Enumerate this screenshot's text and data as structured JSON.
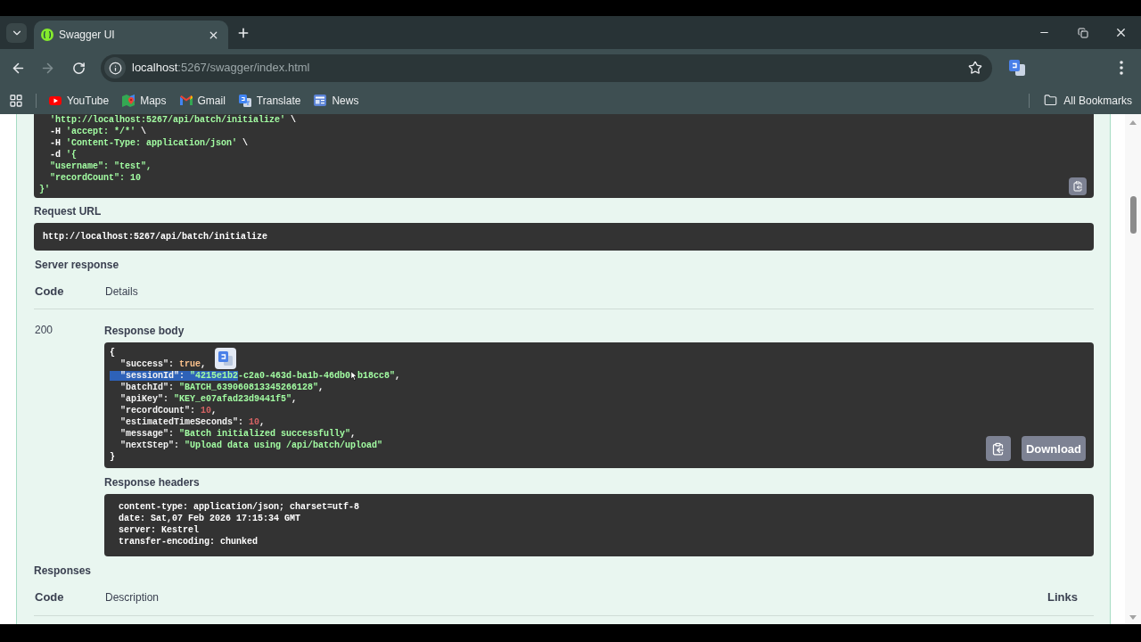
{
  "browser": {
    "tab": {
      "title": "Swagger UI",
      "selected": true
    },
    "address": {
      "host": "localhost",
      "path": ":5267/swagger/index.html"
    },
    "bookmarks": [
      {
        "label": "YouTube",
        "kind": "video"
      },
      {
        "label": "Maps",
        "kind": "map"
      },
      {
        "label": "Gmail",
        "kind": "mail"
      },
      {
        "label": "Translate",
        "kind": "translate"
      },
      {
        "label": "News",
        "kind": "news"
      }
    ],
    "all_bookmarks": "All Bookmarks"
  },
  "curl": {
    "lines": [
      [
        {
          "text": "  'http://localhost:5267/api/batch/initialize'",
          "kind": "string"
        },
        {
          "text": " \\",
          "kind": "plain"
        }
      ],
      [
        {
          "text": "  -H ",
          "kind": "plain"
        },
        {
          "text": "'accept: */*'",
          "kind": "string"
        },
        {
          "text": " \\",
          "kind": "plain"
        }
      ],
      [
        {
          "text": "  -H ",
          "kind": "plain"
        },
        {
          "text": "'Content-Type: application/json'",
          "kind": "string"
        },
        {
          "text": " \\",
          "kind": "plain"
        }
      ],
      [
        {
          "text": "  -d ",
          "kind": "plain"
        },
        {
          "text": "'{",
          "kind": "string"
        }
      ],
      [
        {
          "text": "  \"username\": \"test\",",
          "kind": "string"
        }
      ],
      [
        {
          "text": "  \"recordCount\": 10",
          "kind": "string"
        }
      ],
      [
        {
          "text": "}'",
          "kind": "string"
        }
      ]
    ]
  },
  "request_url": {
    "label": "Request URL",
    "value": "http://localhost:5267/api/batch/initialize"
  },
  "server_response": {
    "label": "Server response",
    "columns": [
      "Code",
      "Details"
    ],
    "rows": [
      {
        "code": "200",
        "response_body": {
          "label": "Response body",
          "download": "Download",
          "lines": [
            [
              {
                "text": "{",
                "kind": "punct",
                "selected": false
              }
            ],
            [
              {
                "text": "  \"success\": ",
                "kind": "key",
                "selected": false
              },
              {
                "text": "true",
                "kind": "literal",
                "selected": false
              },
              {
                "text": ",",
                "kind": "punct",
                "selected": false
              }
            ],
            [
              {
                "text": "  \"sessionId\": ",
                "kind": "key",
                "selected": true
              },
              {
                "text": "\"4215e1b2",
                "kind": "string",
                "selected": true
              },
              {
                "text": "-c2a0-463d-ba1b-46db0",
                "kind": "string",
                "selected": false,
                "pointer_after": true
              },
              {
                "text": "b18cc8\"",
                "kind": "string",
                "selected": false
              },
              {
                "text": ",",
                "kind": "punct",
                "selected": false
              }
            ],
            [
              {
                "text": "  \"batchId\": ",
                "kind": "key",
                "selected": false
              },
              {
                "text": "\"BATCH_639060813345266128\"",
                "kind": "string",
                "selected": false
              },
              {
                "text": ",",
                "kind": "punct",
                "selected": false
              }
            ],
            [
              {
                "text": "  \"apiKey\": ",
                "kind": "key",
                "selected": false
              },
              {
                "text": "\"KEY_e07afad23d9441f5\"",
                "kind": "string",
                "selected": false
              },
              {
                "text": ",",
                "kind": "punct",
                "selected": false
              }
            ],
            [
              {
                "text": "  \"recordCount\": ",
                "kind": "key",
                "selected": false
              },
              {
                "text": "10",
                "kind": "number",
                "selected": false
              },
              {
                "text": ",",
                "kind": "punct",
                "selected": false
              }
            ],
            [
              {
                "text": "  \"estimatedTimeSeconds\": ",
                "kind": "key",
                "selected": false
              },
              {
                "text": "10",
                "kind": "number",
                "selected": false
              },
              {
                "text": ",",
                "kind": "punct",
                "selected": false
              }
            ],
            [
              {
                "text": "  \"message\": ",
                "kind": "key",
                "selected": false
              },
              {
                "text": "\"Batch initialized successfully\"",
                "kind": "string",
                "selected": false
              },
              {
                "text": ",",
                "kind": "punct",
                "selected": false
              }
            ],
            [
              {
                "text": "  \"nextStep\": ",
                "kind": "key",
                "selected": false
              },
              {
                "text": "\"Upload data using /api/batch/upload\"",
                "kind": "string",
                "selected": false
              }
            ],
            [
              {
                "text": "}",
                "kind": "punct",
                "selected": false
              }
            ]
          ]
        },
        "response_headers": {
          "label": "Response headers",
          "lines": [
            "content-type: application/json; charset=utf-8",
            "date: Sat,07 Feb 2026 17:15:34 GMT",
            "server: Kestrel",
            "transfer-encoding: chunked"
          ]
        }
      }
    ]
  },
  "responses": {
    "label": "Responses",
    "columns": [
      "Code",
      "Description",
      "Links"
    ]
  }
}
